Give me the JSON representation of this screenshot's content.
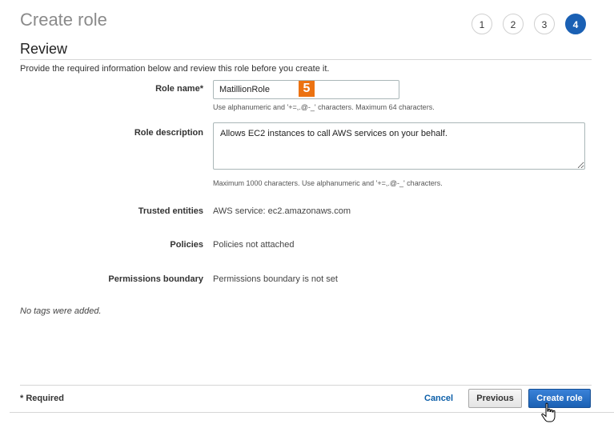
{
  "page": {
    "title": "Create role"
  },
  "steps": [
    "1",
    "2",
    "3",
    "4"
  ],
  "active_step": 4,
  "review": {
    "title": "Review",
    "intro": "Provide the required information below and review this role before you create it."
  },
  "form": {
    "role_name": {
      "label": "Role name*",
      "value": "MatillionRole",
      "help": "Use alphanumeric and '+=,.@-_' characters. Maximum 64 characters."
    },
    "badge": "5",
    "role_description": {
      "label": "Role description",
      "value": "Allows EC2 instances to call AWS services on your behalf.",
      "help": "Maximum 1000 characters. Use alphanumeric and '+=,.@-_' characters."
    },
    "trusted_entities": {
      "label": "Trusted entities",
      "value": "AWS service: ec2.amazonaws.com"
    },
    "policies": {
      "label": "Policies",
      "value": "Policies not attached"
    },
    "permissions_boundary": {
      "label": "Permissions boundary",
      "value": "Permissions boundary is not set"
    }
  },
  "no_tags": "No tags were added.",
  "footer": {
    "required_note": "* Required",
    "cancel_label": "Cancel",
    "previous_label": "Previous",
    "create_label": "Create role"
  },
  "colors": {
    "primary": "#1a60b4",
    "link": "#0b5ea8",
    "badge": "#ec7211"
  },
  "icons": {
    "cursor": "hand-pointer-icon"
  }
}
